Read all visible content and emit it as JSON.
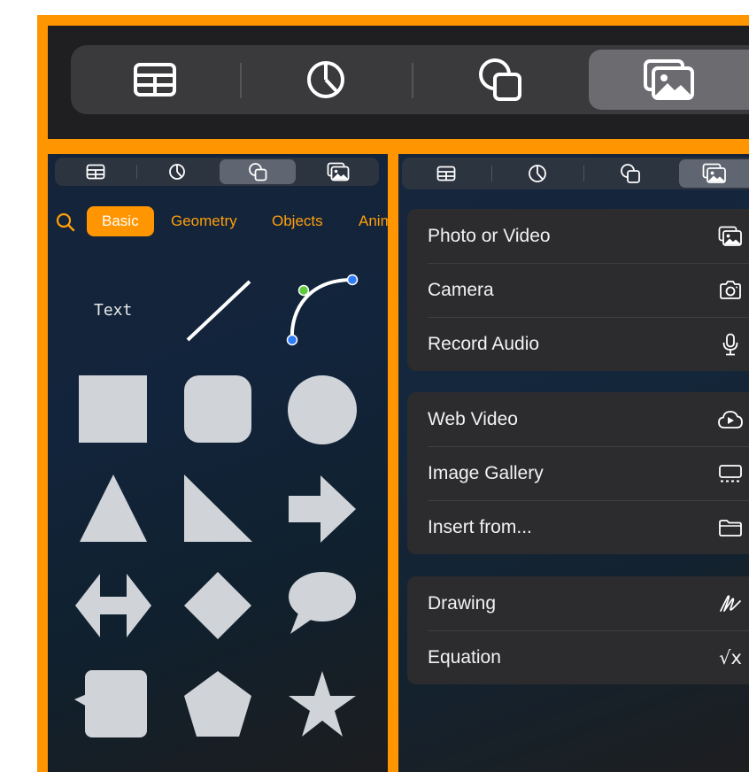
{
  "top_toolbar": {
    "tabs": [
      {
        "icon": "table-icon",
        "selected": false
      },
      {
        "icon": "chart-icon",
        "selected": false
      },
      {
        "icon": "shapes-icon",
        "selected": false
      },
      {
        "icon": "media-icon",
        "selected": true
      }
    ]
  },
  "shapes_panel": {
    "tabs": [
      {
        "icon": "table-icon",
        "selected": false
      },
      {
        "icon": "chart-icon",
        "selected": false
      },
      {
        "icon": "shapes-icon",
        "selected": true
      },
      {
        "icon": "media-icon",
        "selected": false
      }
    ],
    "categories": [
      {
        "label": "Basic",
        "selected": true
      },
      {
        "label": "Geometry",
        "selected": false
      },
      {
        "label": "Objects",
        "selected": false
      },
      {
        "label": "Animals",
        "selected": false
      }
    ],
    "text_shape_label": "Text",
    "shape_color": "#d0d4d9",
    "accent_color": "#FF9500"
  },
  "media_panel": {
    "tabs": [
      {
        "icon": "table-icon",
        "selected": false
      },
      {
        "icon": "chart-icon",
        "selected": false
      },
      {
        "icon": "shapes-icon",
        "selected": false
      },
      {
        "icon": "media-icon",
        "selected": true
      }
    ],
    "groups": [
      {
        "items": [
          {
            "label": "Photo or Video",
            "icon": "photo-icon"
          },
          {
            "label": "Camera",
            "icon": "camera-icon"
          },
          {
            "label": "Record Audio",
            "icon": "microphone-icon"
          }
        ]
      },
      {
        "items": [
          {
            "label": "Web Video",
            "icon": "cloud-play-icon"
          },
          {
            "label": "Image Gallery",
            "icon": "gallery-icon"
          },
          {
            "label": "Insert from...",
            "icon": "folder-icon"
          }
        ]
      },
      {
        "items": [
          {
            "label": "Drawing",
            "icon": "pen-scribble-icon"
          },
          {
            "label": "Equation",
            "icon": "square-root-icon",
            "glyph": "√x"
          }
        ]
      }
    ]
  }
}
